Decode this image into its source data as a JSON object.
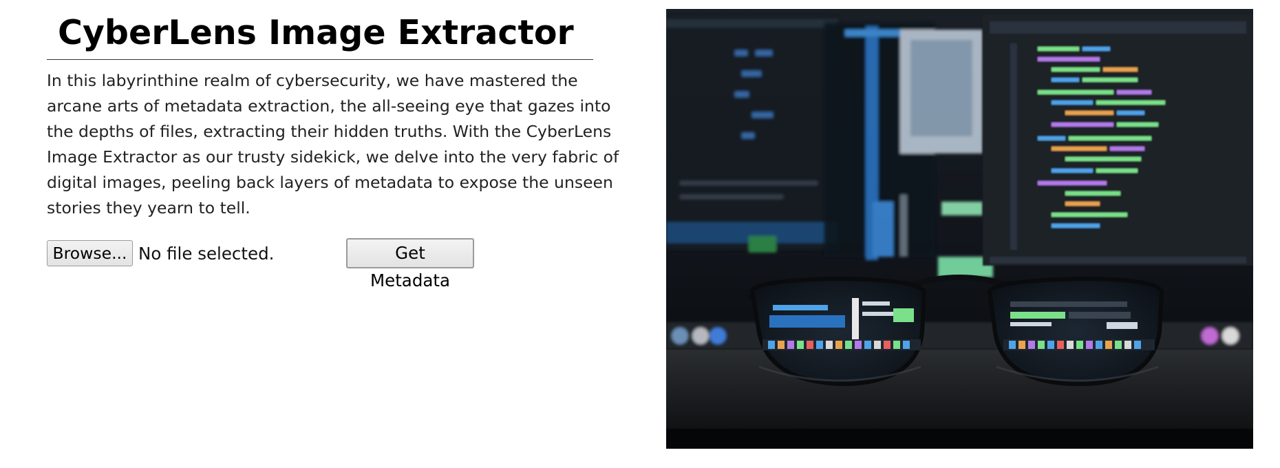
{
  "page": {
    "title": "CyberLens Image Extractor",
    "intro": "In this labyrinthine realm of cybersecurity, we have mastered the arcane arts of metadata extraction, the all-seeing eye that gazes into the depths of files, extracting their hidden truths. With the CyberLens Image Extractor as our trusty sidekick, we delve into the very fabric of digital images, peeling back layers of metadata to expose the unseen stories they yearn to tell."
  },
  "form": {
    "browse_label": "Browse...",
    "file_status": "No file selected.",
    "submit_label": "Get Metadata"
  },
  "image": {
    "subject": "eyeglasses-in-front-of-code-monitors",
    "colors": {
      "background": "#0b0d10",
      "code_green": "#7be08a",
      "code_blue": "#4fa3e8",
      "code_purple": "#b27ae8",
      "code_orange": "#e8a34f"
    }
  }
}
